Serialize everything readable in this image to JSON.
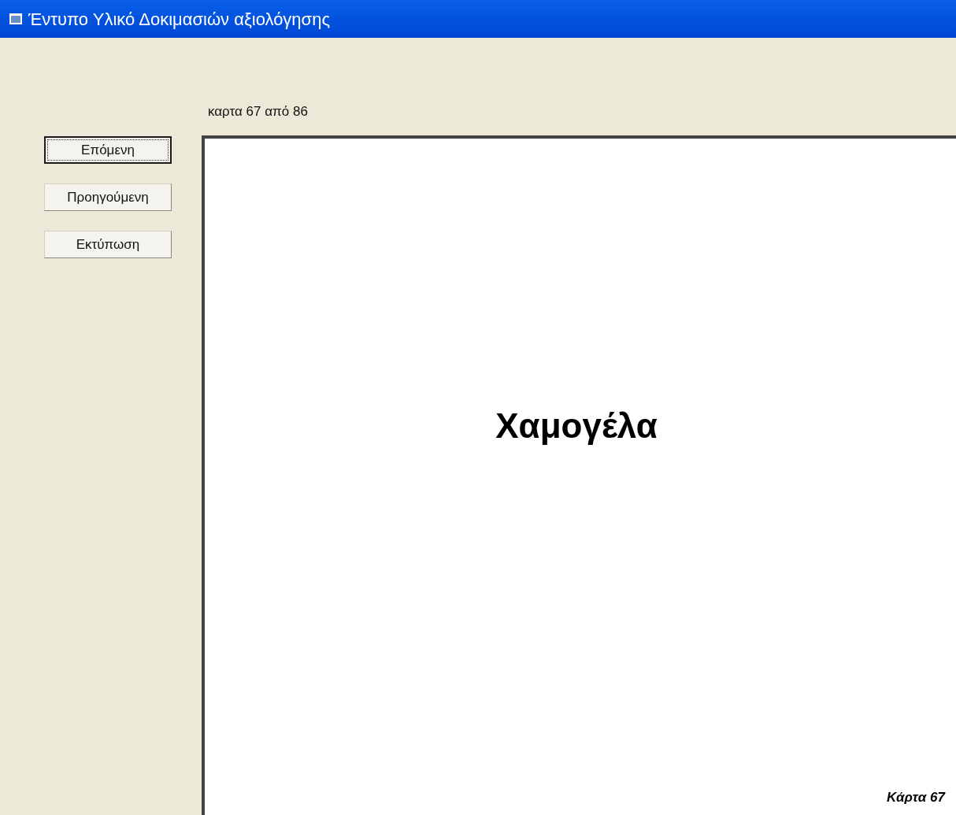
{
  "window": {
    "title": "Έντυπο Υλικό Δοκιμασιών αξιολόγησης"
  },
  "counter": "καρτα 67 από 86",
  "buttons": [
    {
      "label": "Επόμενη",
      "focused": true
    },
    {
      "label": "Προηγούμενη",
      "focused": false
    },
    {
      "label": "Εκτύπωση",
      "focused": false
    }
  ],
  "card": {
    "word": "Χαμογέλα",
    "footer": "Κάρτα 67"
  }
}
